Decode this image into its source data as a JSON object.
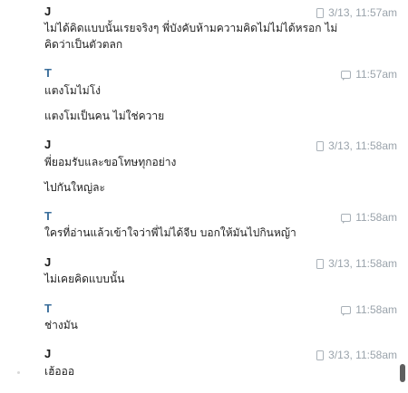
{
  "messages": [
    {
      "sender": "J",
      "sender_color": "#1a1a1a",
      "device": "phone-icon",
      "time": "3/13, 11:57am",
      "lines": [
        "ไม่ได้คิดแบบนั้นเรยจริงๆ พี่บังคับห้ามความคิดไม่ไม่ได้หรอก ไม่",
        "คิดว่าเป็นตัวตลก"
      ]
    },
    {
      "sender": "T",
      "sender_color": "#3a6e9b",
      "device": "chat-bubble-icon",
      "time": "11:57am",
      "lines": [
        "แตงโมไม่โง่",
        "แตงโมเป็นคน ไม่ใช่ควาย"
      ]
    },
    {
      "sender": "J",
      "sender_color": "#1a1a1a",
      "device": "phone-icon",
      "time": "3/13, 11:58am",
      "lines": [
        "พี่ยอมรับและขอโทษทุกอย่าง",
        "ไปกันใหญ่ละ"
      ]
    },
    {
      "sender": "T",
      "sender_color": "#3a6e9b",
      "device": "chat-bubble-icon",
      "time": "11:58am",
      "lines": [
        "ใครที่อ่านแล้วเข้าใจว่าพี่ไม่ได้จีบ บอกให้มันไปกินหญ้า"
      ]
    },
    {
      "sender": "J",
      "sender_color": "#1a1a1a",
      "device": "phone-icon",
      "time": "3/13, 11:58am",
      "lines": [
        "ไม่เคยคิดแบบนั้น"
      ]
    },
    {
      "sender": "T",
      "sender_color": "#3a6e9b",
      "device": "chat-bubble-icon",
      "time": "11:58am",
      "lines": [
        "ช่างมัน"
      ]
    },
    {
      "sender": "J",
      "sender_color": "#1a1a1a",
      "device": "phone-icon",
      "time": "3/13, 11:58am",
      "lines": [
        "เฮ้อออ"
      ]
    }
  ]
}
